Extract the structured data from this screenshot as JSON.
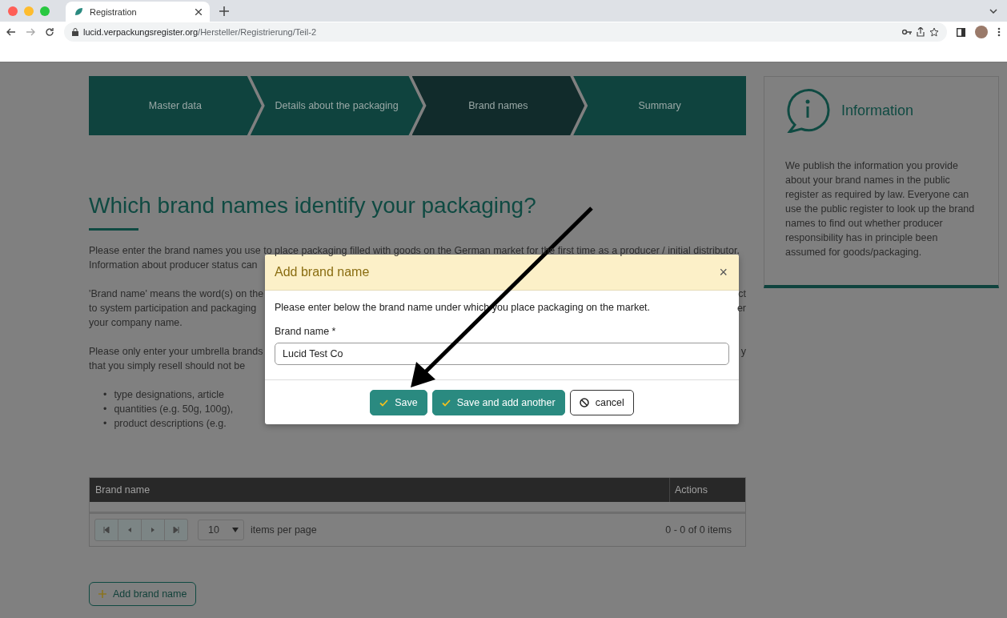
{
  "browser": {
    "tab_title": "Registration",
    "url_host": "lucid.verpackungsregister.org",
    "url_path": "/Hersteller/Registrierung/Teil-2"
  },
  "steps": [
    {
      "label": "Master data",
      "selected": false
    },
    {
      "label": "Details about the packaging",
      "selected": false
    },
    {
      "label": "Brand names",
      "selected": true
    },
    {
      "label": "Summary",
      "selected": false
    }
  ],
  "heading": "Which brand names identify your packaging?",
  "paragraphs": [
    [
      {
        "left": "Please enter the brand names you use to place packaging filled with goods on the German market for the first time as a producer / initial distributor."
      },
      {
        "left": "Information about producer status can"
      }
    ],
    [
      {
        "left": "'Brand name' means the word(s) on the",
        "right": "ct"
      },
      {
        "left": "to system participation and packaging",
        "right": "er"
      },
      {
        "left": "your company name."
      }
    ],
    [
      {
        "left": "Please only enter your umbrella brands",
        "right": "y"
      },
      {
        "left": "that you simply resell should not be"
      }
    ]
  ],
  "bullets": [
    {
      "marker": "•",
      "text": "type designations, article"
    },
    {
      "marker": "•",
      "text": "quantities (e.g. 50g, 100g),"
    },
    {
      "marker": "•",
      "text": "product descriptions (e.g."
    }
  ],
  "table": {
    "columns": [
      "Brand name",
      "Actions"
    ],
    "page_size": "10",
    "page_size_label": "items per page",
    "count": "0 - 0 of 0 items"
  },
  "add_button": "Add brand name",
  "info": {
    "title": "Information",
    "text": "We publish the information you provide about your brand names in the public register as required by law. Everyone can use the public register to look up the brand names to find out whether producer responsibility has in principle been assumed for goods/packaging."
  },
  "modal": {
    "title": "Add brand name",
    "close": "×",
    "intro": "Please enter below the brand name under which you place packaging on the market.",
    "field_label": "Brand name *",
    "field_value": "Lucid Test Co",
    "buttons": [
      {
        "label": "Save",
        "kind": "primary"
      },
      {
        "label": "Save and add another",
        "kind": "primary"
      },
      {
        "label": "cancel",
        "kind": "cancel"
      }
    ]
  }
}
